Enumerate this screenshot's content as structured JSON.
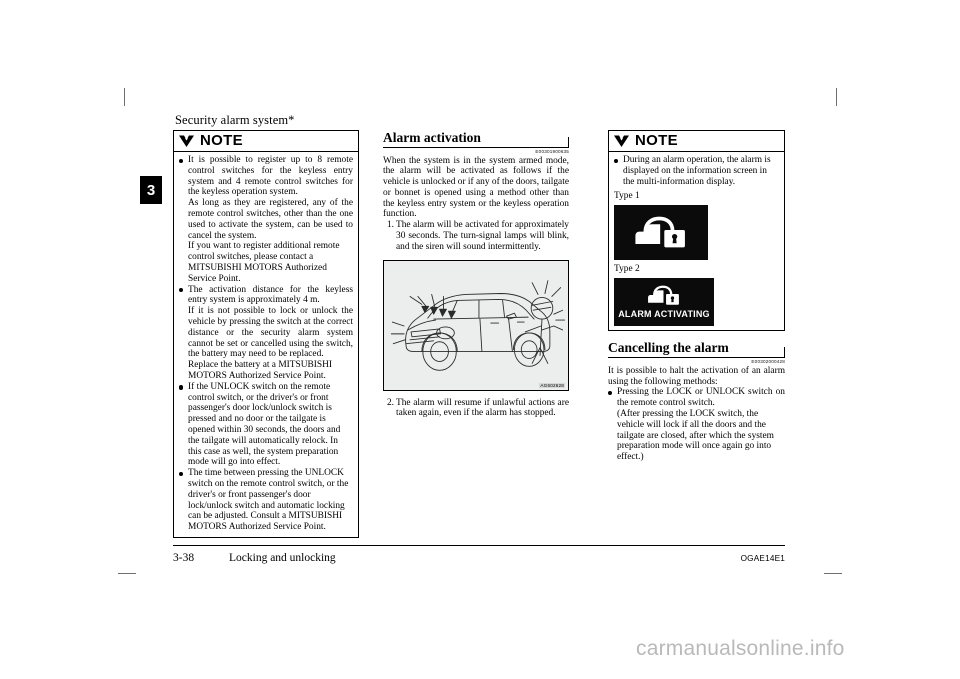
{
  "page": {
    "running_head": "Security alarm system*",
    "chapter_tab": "3",
    "watermark": "carmanualsonline.info"
  },
  "footer": {
    "page_number": "3-38",
    "title": "Locking and unlocking",
    "doc_code": "OGAE14E1"
  },
  "column_left": {
    "note": {
      "label": "NOTE",
      "icon": "mitsubishi-diamond-icon",
      "bullets": [
        {
          "paragraphs": [
            "It is possible to register up to 8 remote control switches for the keyless entry system and 4 remote control switches for the keyless operation system.",
            "As long as they are registered, any of the remote control switches, other than the one used to activate the system, can be used to cancel the system.",
            "If you want to register additional remote control switches, please contact a MITSUBISHI MOTORS Authorized Service Point."
          ]
        },
        {
          "paragraphs": [
            "The activation distance for the keyless entry system is approximately 4 m.",
            "If it is not possible to lock or unlock the vehicle by pressing the switch at the correct distance or the security alarm system cannot be set or cancelled using the switch, the battery may need to be replaced.",
            "Replace the battery at a MITSUBISHI MOTORS Authorized Service Point."
          ]
        },
        {
          "paragraphs": [
            "If the UNLOCK switch on the remote control switch, or the driver's or front passenger's door lock/unlock switch is pressed and no door or the tailgate is opened within 30 seconds, the doors and the tailgate will automatically relock. In this case as well, the system preparation mode will go into effect."
          ]
        },
        {
          "paragraphs": [
            "The time between pressing the UNLOCK switch on the remote control switch, or the driver's or front passenger's door lock/unlock switch and automatic locking can be adjusted. Consult a MITSUBISHI MOTORS Authorized Service Point."
          ]
        }
      ]
    }
  },
  "column_middle": {
    "heading": "Alarm activation",
    "ref_code": "E00301900635",
    "intro": "When the system is in the system armed mode, the alarm will be activated as follows if the vehicle is unlocked or if any of the doors, tailgate or bonnet is opened using a method other than the keyless entry system or the keyless operation function.",
    "steps": [
      {
        "number": "1.",
        "text": "The alarm will be activated for approximately 30 seconds. The turn-signal lamps will blink, and the siren will sound intermittently."
      },
      {
        "number": "2.",
        "text": "The alarm will resume if unlawful actions are taken again, even if the alarm has stopped."
      }
    ],
    "figure": {
      "code": "AG602628",
      "description": "line-drawing of a person attempting to break into a vehicle with alarm signals"
    }
  },
  "column_right": {
    "note": {
      "label": "NOTE",
      "icon": "mitsubishi-diamond-icon",
      "bullets": [
        {
          "paragraphs": [
            "During an alarm operation, the alarm is displayed on the information screen in the multi-information display."
          ]
        }
      ],
      "type1_label": "Type 1",
      "type2_label": "Type 2",
      "type1_panel": {
        "icon": "car-open-padlock-icon",
        "caption": ""
      },
      "type2_panel": {
        "icon": "car-open-padlock-icon",
        "caption": "ALARM ACTIVATING"
      }
    },
    "cancel": {
      "heading": "Cancelling the alarm",
      "ref_code": "E00302000428",
      "intro": "It is possible to halt the activation of an alarm using the following methods:",
      "bullets": [
        {
          "paragraphs": [
            "Pressing the LOCK or UNLOCK switch on the remote control switch.",
            "(After pressing the LOCK switch, the vehicle will lock if all the doors and the tailgate are closed, after which the system preparation mode will once again go into effect.)"
          ]
        }
      ]
    }
  }
}
